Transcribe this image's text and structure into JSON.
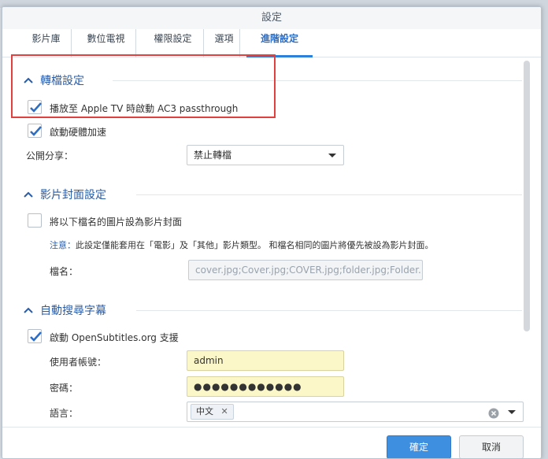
{
  "dialog": {
    "title": "設定"
  },
  "tabs": [
    {
      "label": "影片庫"
    },
    {
      "label": "數位電視"
    },
    {
      "label": "權限設定"
    },
    {
      "label": "選項"
    },
    {
      "label": "進階設定"
    }
  ],
  "transcode": {
    "heading": "轉檔設定",
    "apple_tv_label": "播放至 Apple TV 時啟動 AC3 passthrough",
    "apple_tv_checked": true,
    "hw_accel_label": "啟動硬體加速",
    "hw_accel_checked": true,
    "public_share_label": "公開分享：",
    "public_share_value": "禁止轉檔"
  },
  "cover": {
    "heading": "影片封面設定",
    "use_file_label": "將以下檔名的圖片設為影片封面",
    "use_file_checked": false,
    "note_prefix": "注意：",
    "note_text": "此設定僅能套用在「電影」及「其他」影片類型。 和檔名相同的圖片將優先被設為影片封面。",
    "filename_label": "檔名：",
    "filename_value": "cover.jpg;Cover.jpg;COVER.jpg;folder.jpg;Folder."
  },
  "subtitles": {
    "heading": "自動搜尋字幕",
    "enable_label": "啟動 OpenSubtitles.org 支援",
    "enable_checked": true,
    "username_label": "使用者帳號：",
    "username_value": "admin",
    "password_label": "密碼：",
    "password_value": "●●●●●●●●●●●●",
    "language_label": "語言：",
    "language_tag": "中文"
  },
  "footer": {
    "ok_label": "確定",
    "cancel_label": "取消"
  },
  "icons": {
    "chevron": "chevron-up-icon",
    "check": "checkmark-icon",
    "dropdown": "caret-down-icon",
    "clear": "clear-circle-icon"
  }
}
